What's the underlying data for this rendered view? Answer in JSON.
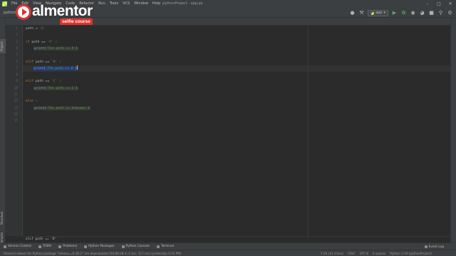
{
  "menu": {
    "items": [
      "File",
      "Edit",
      "View",
      "Navigate",
      "Code",
      "Refactor",
      "Run",
      "Tools",
      "VCS",
      "Window",
      "Help"
    ],
    "window_title": "pythonProject - app.py"
  },
  "navbar": {
    "project": "pythonProject",
    "run_config": "app"
  },
  "tab": {
    "label": "app.py"
  },
  "editor": {
    "line_numbers": [
      "1",
      "2",
      "3",
      "4",
      "5",
      "6",
      "7",
      "8",
      "9",
      "10",
      "11",
      "12",
      "13",
      "14",
      "15"
    ],
    "lines": [
      "path = 'A'",
      "",
      "if path == 'A' :",
      "    print('The path is A')",
      "",
      "elif path == 'B' :",
      "    print('The path is B')",
      "",
      "elif path == 'C' :",
      "    print('The path is C')",
      "",
      "else :",
      "    print('The path is Unknown')",
      "",
      ""
    ],
    "breadcrumb": "elif path == 'B'"
  },
  "tool_windows": {
    "version_control": "Version Control",
    "todo": "TODO",
    "problems": "Problems",
    "python_packages": "Python Packages",
    "python_console": "Python Console",
    "terminal": "Terminal",
    "event_log": "Event Log"
  },
  "side_tabs": {
    "project": "Project",
    "structure": "Structure",
    "bookmarks": "Bookmarks"
  },
  "status": {
    "message": "Shared indexes for Python package \"wheel==0.36.2\" are downloaded (56.86 kB in 1 sec, 117 ms) (yesterday 3:12 PM)",
    "position": "7:26 (21 chars)",
    "line_sep": "CRLF",
    "encoding": "UTF-8",
    "indent": "4 spaces",
    "interpreter": "Python 3.10 (pythonProject)"
  },
  "logo": {
    "word": "almentor",
    "sub": "selfie course"
  },
  "colors": {
    "background": "#2b2b2b",
    "keyword": "#cc7832",
    "string": "#6a8759",
    "builtin": "#8888c6",
    "selection": "#214283",
    "brand_red": "#e0312e"
  }
}
